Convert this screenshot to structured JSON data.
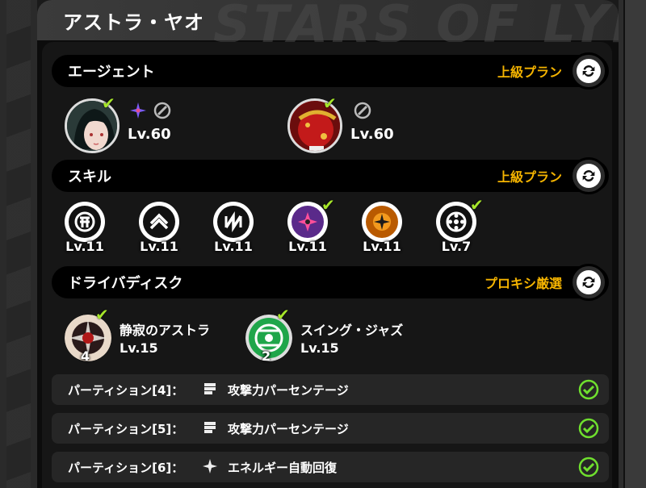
{
  "header": {
    "title": "アストラ・ヤオ",
    "watermark": "STARS OF LYRA STA"
  },
  "agent_section": {
    "label": "エージェント",
    "plan": "上級プラン",
    "agents": [
      {
        "level": "Lv.60",
        "equipped": true
      },
      {
        "level": "Lv.60",
        "equipped": true
      }
    ]
  },
  "skill_section": {
    "label": "スキル",
    "plan": "上級プラン",
    "skills": [
      {
        "level": "Lv.11",
        "icon": "basic-attack-icon",
        "checked": false
      },
      {
        "level": "Lv.11",
        "icon": "dodge-icon",
        "checked": false
      },
      {
        "level": "Lv.11",
        "icon": "assist-icon",
        "checked": false
      },
      {
        "level": "Lv.11",
        "icon": "special-attack-icon",
        "checked": true
      },
      {
        "level": "Lv.11",
        "icon": "chain-attack-icon",
        "checked": false
      },
      {
        "level": "Lv.7",
        "icon": "core-skill-icon",
        "checked": true
      }
    ]
  },
  "disc_section": {
    "label": "ドライバディスク",
    "plan": "プロキシ厳選",
    "discs": [
      {
        "name": "静寂のアストラ",
        "level": "Lv.15",
        "count": "4"
      },
      {
        "name": "スイング・ジャズ",
        "level": "Lv.15",
        "count": "2"
      }
    ]
  },
  "partitions": [
    {
      "label": "パーティション[4]：",
      "value": "攻撃力パーセンテージ",
      "icon": "attack-fist-icon"
    },
    {
      "label": "パーティション[5]：",
      "value": "攻撃力パーセンテージ",
      "icon": "attack-fist-icon"
    },
    {
      "label": "パーティション[6]：",
      "value": "エネルギー自動回復",
      "icon": "energy-sparkle-icon"
    }
  ],
  "colors": {
    "accent": "#f5b400",
    "check": "#a6e62a",
    "section_bg": "#000000",
    "panel_bg": "#161616"
  }
}
